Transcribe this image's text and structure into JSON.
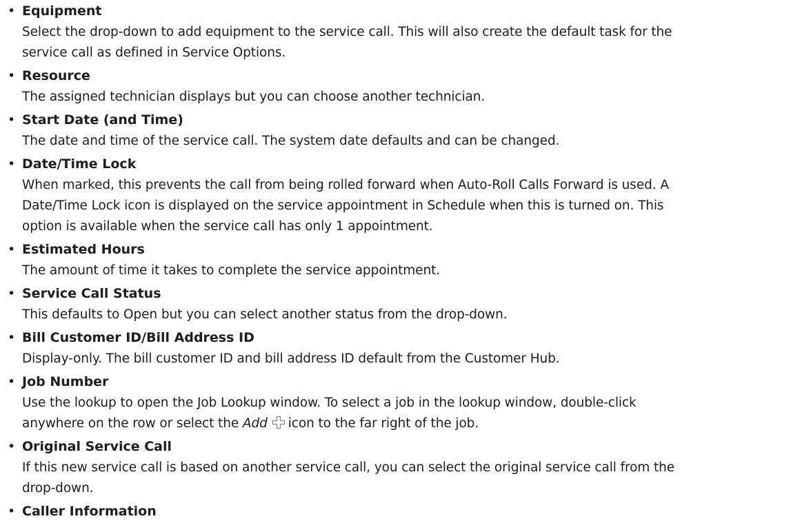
{
  "fields": [
    {
      "name": "Equipment",
      "lines": [
        "Select the drop-down to add equipment to the service call. This will also create the default task for the",
        "service call as defined in Service Options."
      ]
    },
    {
      "name": "Resource",
      "lines": [
        "The assigned technician displays but you can choose another technician."
      ]
    },
    {
      "name": "Start Date (and Time)",
      "lines": [
        "The date and time of the service call. The system date defaults and can be changed."
      ]
    },
    {
      "name": "Date/Time Lock",
      "lines": [
        "When marked, this prevents the call from being rolled forward when Auto-Roll Calls Forward is used. A",
        "Date/Time Lock icon is displayed on the service appointment in Schedule when this is turned on. This",
        "option is available when the service call has only 1 appointment."
      ]
    },
    {
      "name": "Estimated Hours",
      "lines": [
        "The amount of time it takes to complete the service appointment."
      ]
    },
    {
      "name": "Service Call Status",
      "lines": [
        "This defaults to Open but you can select another status from the drop-down."
      ]
    },
    {
      "name": "Bill Customer ID/Bill Address ID",
      "lines": [
        "Display-only. The bill customer ID and bill address ID default from the Customer Hub."
      ]
    },
    {
      "name": "Job Number",
      "line1": "Use the lookup to open the Job Lookup window. To select a job in the lookup window, double-click",
      "line2_before": "anywhere on the row or select the",
      "line2_em": "Add",
      "line2_icon": "add-plus-icon",
      "line2_after": "icon to the far right of the job."
    },
    {
      "name": "Original Service Call",
      "lines": [
        "If this new service call is based on another service call, you can select the original service call from the",
        "drop-down."
      ]
    },
    {
      "name": "Caller Information",
      "lines": []
    }
  ],
  "bullet_char": "•",
  "colors": {
    "text": "#1e1e1e",
    "icon_stroke": "#8a8a8a"
  }
}
